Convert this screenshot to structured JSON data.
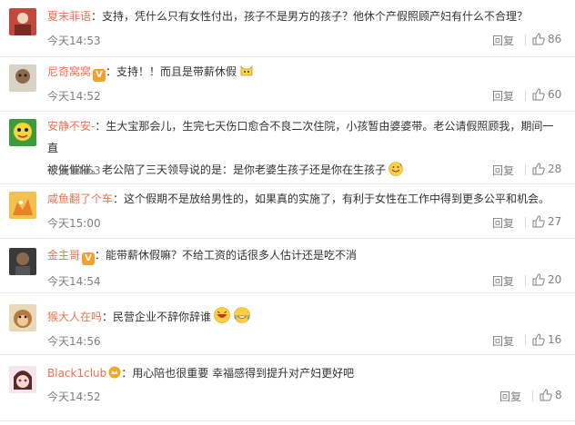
{
  "comments": [
    {
      "user": "夏末菲语",
      "sep": "：",
      "text": "支持，凭什么只有女性付出，孩子不是男方的孩子？他休个产假照顾产妇有什么不合理？",
      "text2": "",
      "time": "今天14:53",
      "reply": "回复",
      "likes": "86"
    },
    {
      "user": "尼奇窝窝",
      "sep": "：",
      "text": "支持！！而且是带薪休假",
      "text2": "",
      "time": "今天14:52",
      "reply": "回复",
      "likes": "60"
    },
    {
      "user": "安静不安-",
      "sep": "：",
      "text": "生大宝那会儿，生完七天伤口愈合不良二次住院，小孩暂由婆婆带。老公请假照顾我，期间一直",
      "text2": "被催催催。老公陪了三天领导说的是：是你老婆生孩子还是你在生孩子",
      "time": "今天14:53",
      "reply": "回复",
      "likes": "28"
    },
    {
      "user": "咸鱼翻了个车",
      "sep": "：",
      "text": "这个假期不是放给男性的，如果真的实施了，有利于女性在工作中得到更多公平和机会。",
      "text2": "",
      "time": "今天15:00",
      "reply": "回复",
      "likes": "27"
    },
    {
      "user": "金主哥",
      "sep": "：",
      "text": "能带薪休假嘛？不给工资的话很多人估计还是吃不消",
      "text2": "",
      "time": "今天14:54",
      "reply": "回复",
      "likes": "20"
    },
    {
      "user": "猴大人在吗",
      "sep": "：",
      "text": "民营企业不辞你辞谁",
      "text2": "",
      "time": "今天14:56",
      "reply": "回复",
      "likes": "16"
    },
    {
      "user": "Black1club",
      "sep": "：",
      "text": "用心陪也很重要 幸福感得到提升对产妇更好吧",
      "text2": "",
      "time": "今天14:52",
      "reply": "回复",
      "likes": "8"
    }
  ],
  "colors": {
    "username": "#eb7350",
    "meta": "#808080",
    "text": "#333333"
  }
}
